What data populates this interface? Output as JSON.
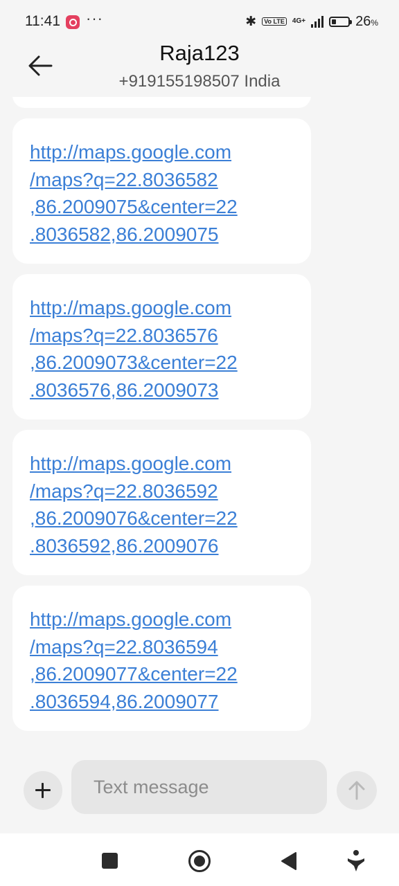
{
  "status_bar": {
    "time": "11:41",
    "dots": "···",
    "network": "4G+",
    "volte": "Vo LTE",
    "battery_level": 0.26,
    "battery_percent": "26",
    "battery_unit": "%"
  },
  "header": {
    "contact_name": "Raja123",
    "phone_line": "+919155198507 India"
  },
  "messages": [
    "http://maps.google.com\n/maps?q=22.8036582\n,86.2009075&center=22\n.8036582,86.2009075",
    "http://maps.google.com\n/maps?q=22.8036576\n,86.2009073&center=22\n.8036576,86.2009073",
    "http://maps.google.com\n/maps?q=22.8036592\n,86.2009076&center=22\n.8036592,86.2009076",
    "http://maps.google.com\n/maps?q=22.8036594\n,86.2009077&center=22\n.8036594,86.2009077"
  ],
  "compose": {
    "placeholder": "Text message"
  },
  "colors": {
    "link": "#3b7fd6",
    "background": "#f5f5f5",
    "bubble": "#ffffff"
  },
  "icons": {
    "back": "arrow-left-icon",
    "attach": "plus-icon",
    "send": "arrow-up-icon",
    "nav": [
      "square-icon",
      "circle-home-icon",
      "triangle-back-icon",
      "accessibility-icon"
    ]
  }
}
